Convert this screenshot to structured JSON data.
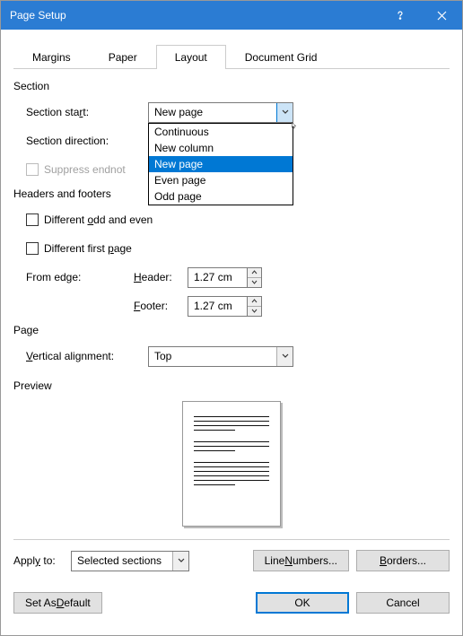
{
  "title": "Page Setup",
  "tabs": {
    "margins": "Margins",
    "paper": "Paper",
    "layout": "Layout",
    "docgrid": "Document Grid"
  },
  "section": {
    "label": "Section",
    "start_label": "Section start:",
    "start_value": "New page",
    "direction_label": "Section direction:",
    "suppress_label": "Suppress endnotes",
    "options": {
      "continuous": "Continuous",
      "newcolumn": "New column",
      "newpage": "New page",
      "evenpage": "Even page",
      "oddpage": "Odd page"
    }
  },
  "headers": {
    "label": "Headers and footers",
    "diff_odd_even": "Different odd and even",
    "diff_first": "Different first page",
    "from_edge": "From edge:",
    "header_label": "Header:",
    "footer_label": "Footer:",
    "header_value": "1.27 cm",
    "footer_value": "1.27 cm"
  },
  "page": {
    "label": "Page",
    "valign_label": "Vertical alignment:",
    "valign_value": "Top"
  },
  "preview": {
    "label": "Preview"
  },
  "apply": {
    "label": "Apply to:",
    "value": "Selected sections"
  },
  "buttons": {
    "line_numbers": "Line Numbers...",
    "borders": "Borders...",
    "set_default": "Set As Default",
    "ok": "OK",
    "cancel": "Cancel"
  }
}
